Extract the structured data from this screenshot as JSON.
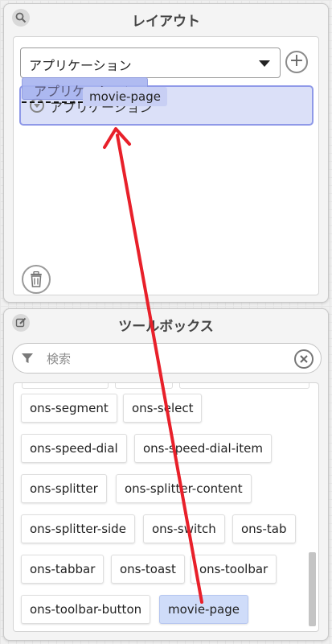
{
  "layout_panel": {
    "title": "レイアウト",
    "header_icon": "search-icon",
    "select_value": "アプリケーション",
    "tree_item_label": "アプリケーション",
    "drag_ghost_label": "アプリケーション",
    "drag_tooltip": "movie-page",
    "add_icon": "plus-circle-icon",
    "trash_icon": "trash-icon"
  },
  "toolbox": {
    "title": "ツールボックス",
    "header_icon": "edit-icon",
    "search_placeholder": "検索",
    "search_value": "",
    "items": [
      "ons-segment",
      "ons-select",
      "ons-speed-dial",
      "ons-speed-dial-item",
      "ons-splitter",
      "ons-splitter-content",
      "ons-splitter-side",
      "ons-switch",
      "ons-tab",
      "ons-tabbar",
      "ons-toast",
      "ons-toolbar",
      "ons-toolbar-button",
      "movie-page"
    ],
    "selected_item": "movie-page"
  },
  "colors": {
    "accent_blue": "#8f99e8",
    "selection_fill": "#dbe0f8",
    "chip_selected": "#cfdcf9",
    "arrow_red": "#e8202a"
  }
}
